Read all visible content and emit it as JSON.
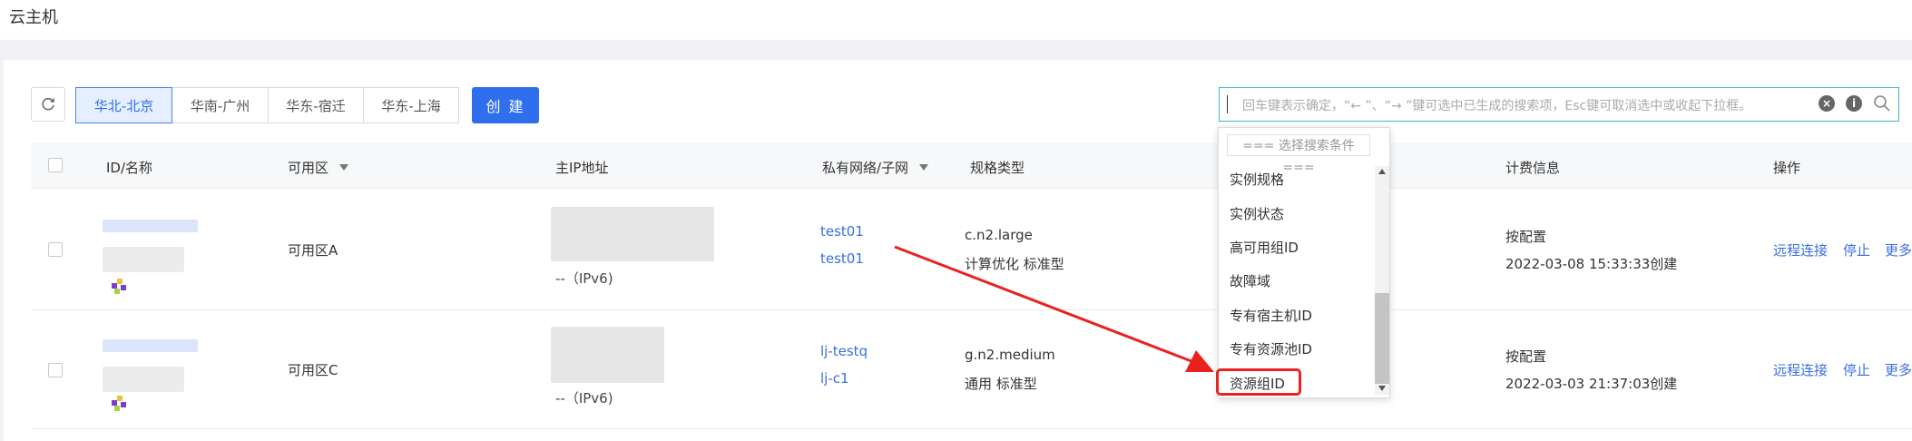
{
  "page": {
    "title": "云主机"
  },
  "toolbar": {
    "regions": [
      {
        "label": "华北-北京",
        "active": true
      },
      {
        "label": "华南-广州",
        "active": false
      },
      {
        "label": "华东-宿迁",
        "active": false
      },
      {
        "label": "华东-上海",
        "active": false
      }
    ],
    "create_label": "创 建"
  },
  "search": {
    "placeholder": "回车键表示确定，“← ”、“→ ”键可选中已生成的搜索项，Esc键可取消选中或收起下拉框。"
  },
  "table": {
    "headers": {
      "id_name": "ID/名称",
      "zone": "可用区",
      "ip": "主IP地址",
      "vpc": "私有网络/子网",
      "spec": "规格类型",
      "billing": "计费信息",
      "actions": "操作"
    },
    "rows": [
      {
        "zone": "可用区A",
        "ipv6": "--（IPv6)",
        "vpc": "test01",
        "subnet": "test01",
        "spec": "c.n2.large",
        "spec_desc": "计算优化 标准型",
        "billing": "按配置",
        "created": "2022-03-08 15:33:33创建",
        "actions": [
          "远程连接",
          "停止",
          "更多"
        ]
      },
      {
        "zone": "可用区C",
        "ipv6": "--（IPv6)",
        "vpc": "lj-testq",
        "subnet": "lj-c1",
        "spec": "g.n2.medium",
        "spec_desc": "通用 标准型",
        "billing": "按配置",
        "created": "2022-03-03 21:37:03创建",
        "actions": [
          "远程连接",
          "停止",
          "更多"
        ]
      }
    ]
  },
  "dropdown": {
    "header": "=== 选择搜索条件 ===",
    "items": [
      "实例规格",
      "实例状态",
      "高可用组ID",
      "故障域",
      "专有宿主机ID",
      "专有资源池ID",
      "资源组ID"
    ],
    "highlighted": "资源组ID"
  },
  "annotation": {
    "color": "#e8231f"
  }
}
